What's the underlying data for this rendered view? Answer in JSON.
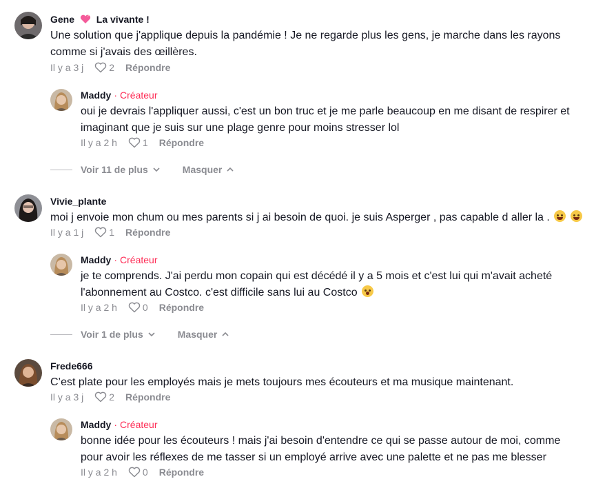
{
  "comments": [
    {
      "username": "Gene",
      "username_suffix": "La vivante !",
      "text_lines": [
        "Une solution que j'applique depuis la pandémie ! Je ne regarde plus les gens, je marche dans les rayons",
        "comme si j'avais des œillères."
      ],
      "time": "Il y a 3 j",
      "likes": "2",
      "reply_label": "Répondre",
      "reply": {
        "username": "Maddy",
        "creator_label": "Créateur",
        "text_lines": [
          "oui je devrais l'appliquer aussi, c'est un bon truc et je me parle beaucoup en me disant de respirer et",
          "imaginant que je suis sur une plage genre pour moins stresser lol"
        ],
        "time": "Il y a 2 h",
        "likes": "1",
        "reply_label": "Répondre"
      },
      "view_more": "Voir 11 de plus",
      "hide": "Masquer"
    },
    {
      "username": "Vivie_plante",
      "text_lines": [
        "moi j envoie mon chum ou mes parents si j ai besoin de quoi. je suis Asperger , pas capable d aller la ."
      ],
      "time": "Il y a 1 j",
      "likes": "1",
      "reply_label": "Répondre",
      "reply": {
        "username": "Maddy",
        "creator_label": "Créateur",
        "text_lines": [
          "je te comprends. J'ai perdu mon copain qui est décédé il y a 5 mois et c'est lui qui m'avait acheté",
          "l'abonnement au Costco. c'est difficile sans lui au Costco"
        ],
        "time": "Il y a 2 h",
        "likes": "0",
        "reply_label": "Répondre"
      },
      "view_more": "Voir 1 de plus",
      "hide": "Masquer"
    },
    {
      "username": "Frede666",
      "text_lines": [
        "C’est plate pour les employés mais je mets toujours mes écouteurs et ma musique maintenant."
      ],
      "time": "Il y a 3 j",
      "likes": "2",
      "reply_label": "Répondre",
      "reply": {
        "username": "Maddy",
        "creator_label": "Créateur",
        "text_lines": [
          "bonne idée pour les écouteurs ! mais j'ai besoin d'entendre ce qui se passe autour de moi, comme",
          "pour avoir les réflexes de me tasser si un employé arrive avec une palette et ne pas me blesser"
        ],
        "time": "Il y a 2 h",
        "likes": "0",
        "reply_label": "Répondre"
      }
    }
  ],
  "icons": {
    "heart": "heart-outline-icon",
    "chevron_down": "chevron-down-icon",
    "chevron_up": "chevron-up-icon",
    "heart_emoji": "pink-heart-emoji",
    "face_emoji": "smiling-face-emoji"
  },
  "colors": {
    "creator": "#fe2c55",
    "muted": "#8a8b91",
    "text": "#161823"
  }
}
